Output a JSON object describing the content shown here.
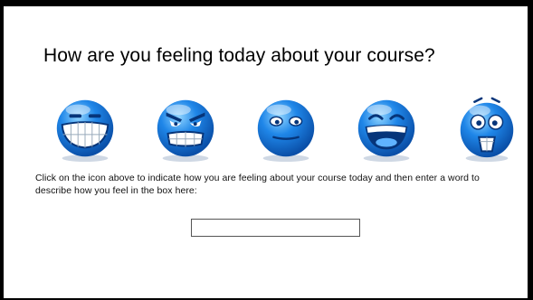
{
  "slide": {
    "title": "How are you feeling today about your course?",
    "instructions": "Click on the icon above to indicate how you are feeling about your course today and then enter a word to describe how you feel in the box here:",
    "feeling_input": {
      "value": "",
      "placeholder": ""
    }
  },
  "emoticons": [
    {
      "icon": "grinning-face-icon"
    },
    {
      "icon": "angry-face-icon"
    },
    {
      "icon": "calm-face-icon"
    },
    {
      "icon": "laughing-face-icon"
    },
    {
      "icon": "shocked-face-icon"
    }
  ],
  "colors": {
    "face_blue": "#1f86e8",
    "face_dark": "#0a4fa8",
    "frame": "#000000"
  }
}
